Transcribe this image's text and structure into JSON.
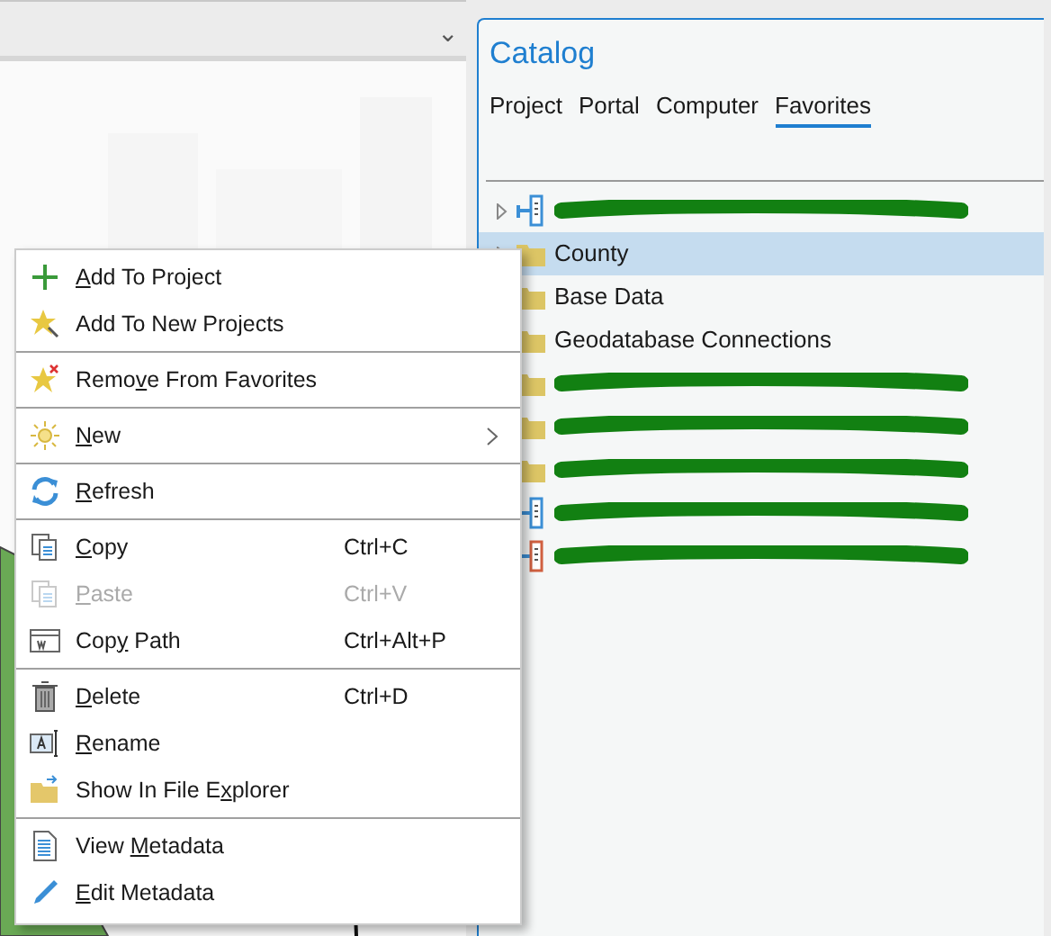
{
  "map_tab_strip": {
    "dropdown": "⌄"
  },
  "catalog": {
    "title": "Catalog",
    "tabs": [
      {
        "label": "Project",
        "selected": false
      },
      {
        "label": "Portal",
        "selected": false
      },
      {
        "label": "Computer",
        "selected": false
      },
      {
        "label": "Favorites",
        "selected": true
      }
    ],
    "items": [
      {
        "kind": "server",
        "redacted": true,
        "expandable": true,
        "selected": false
      },
      {
        "kind": "folder",
        "label": "County",
        "redacted": false,
        "expandable": true,
        "selected": true
      },
      {
        "kind": "folder",
        "label": "Base Data",
        "redacted": false,
        "expandable": false,
        "selected": false
      },
      {
        "kind": "folder",
        "label": "Geodatabase Connections",
        "redacted": false,
        "expandable": false,
        "selected": false
      },
      {
        "kind": "folder",
        "redacted": true,
        "expandable": false,
        "selected": false
      },
      {
        "kind": "folder",
        "redacted": true,
        "expandable": false,
        "selected": false
      },
      {
        "kind": "folder",
        "redacted": true,
        "expandable": false,
        "selected": false
      },
      {
        "kind": "server",
        "redacted": true,
        "expandable": false,
        "selected": false
      },
      {
        "kind": "server-red",
        "redacted": true,
        "expandable": false,
        "selected": false
      }
    ]
  },
  "context_menu": {
    "groups": [
      [
        {
          "kind": "plus",
          "key": "A",
          "post": "dd To Project",
          "disabled": false
        },
        {
          "kind": "star-pin",
          "pre": "Add To New Projects",
          "disabled": false
        }
      ],
      [
        {
          "kind": "star-x",
          "pre": "Remo",
          "key": "v",
          "post": "e From Favorites",
          "disabled": false
        }
      ],
      [
        {
          "kind": "sun",
          "key": "N",
          "post": "ew",
          "submenu": true,
          "disabled": false
        }
      ],
      [
        {
          "kind": "refresh",
          "key": "R",
          "post": "efresh",
          "disabled": false
        }
      ],
      [
        {
          "kind": "copy",
          "key": "C",
          "post": "opy",
          "shortcut": "Ctrl+C",
          "disabled": false
        },
        {
          "kind": "paste",
          "key": "P",
          "post": "aste",
          "shortcut": "Ctrl+V",
          "disabled": true
        },
        {
          "kind": "copy-path",
          "pre": "Cop",
          "key": "y",
          "post": " Path",
          "shortcut": "Ctrl+Alt+P",
          "disabled": false
        }
      ],
      [
        {
          "kind": "trash",
          "key": "D",
          "post": "elete",
          "shortcut": "Ctrl+D",
          "disabled": false
        },
        {
          "kind": "rename",
          "key": "R",
          "post": "ename",
          "disabled": false
        },
        {
          "kind": "folder-open",
          "pre": "Show In File E",
          "key": "x",
          "post": "plorer",
          "disabled": false
        }
      ],
      [
        {
          "kind": "document",
          "pre": "View ",
          "key": "M",
          "post": "etadata",
          "disabled": false
        },
        {
          "kind": "pencil",
          "key": "E",
          "post": "dit Metadata",
          "disabled": false
        }
      ]
    ]
  }
}
